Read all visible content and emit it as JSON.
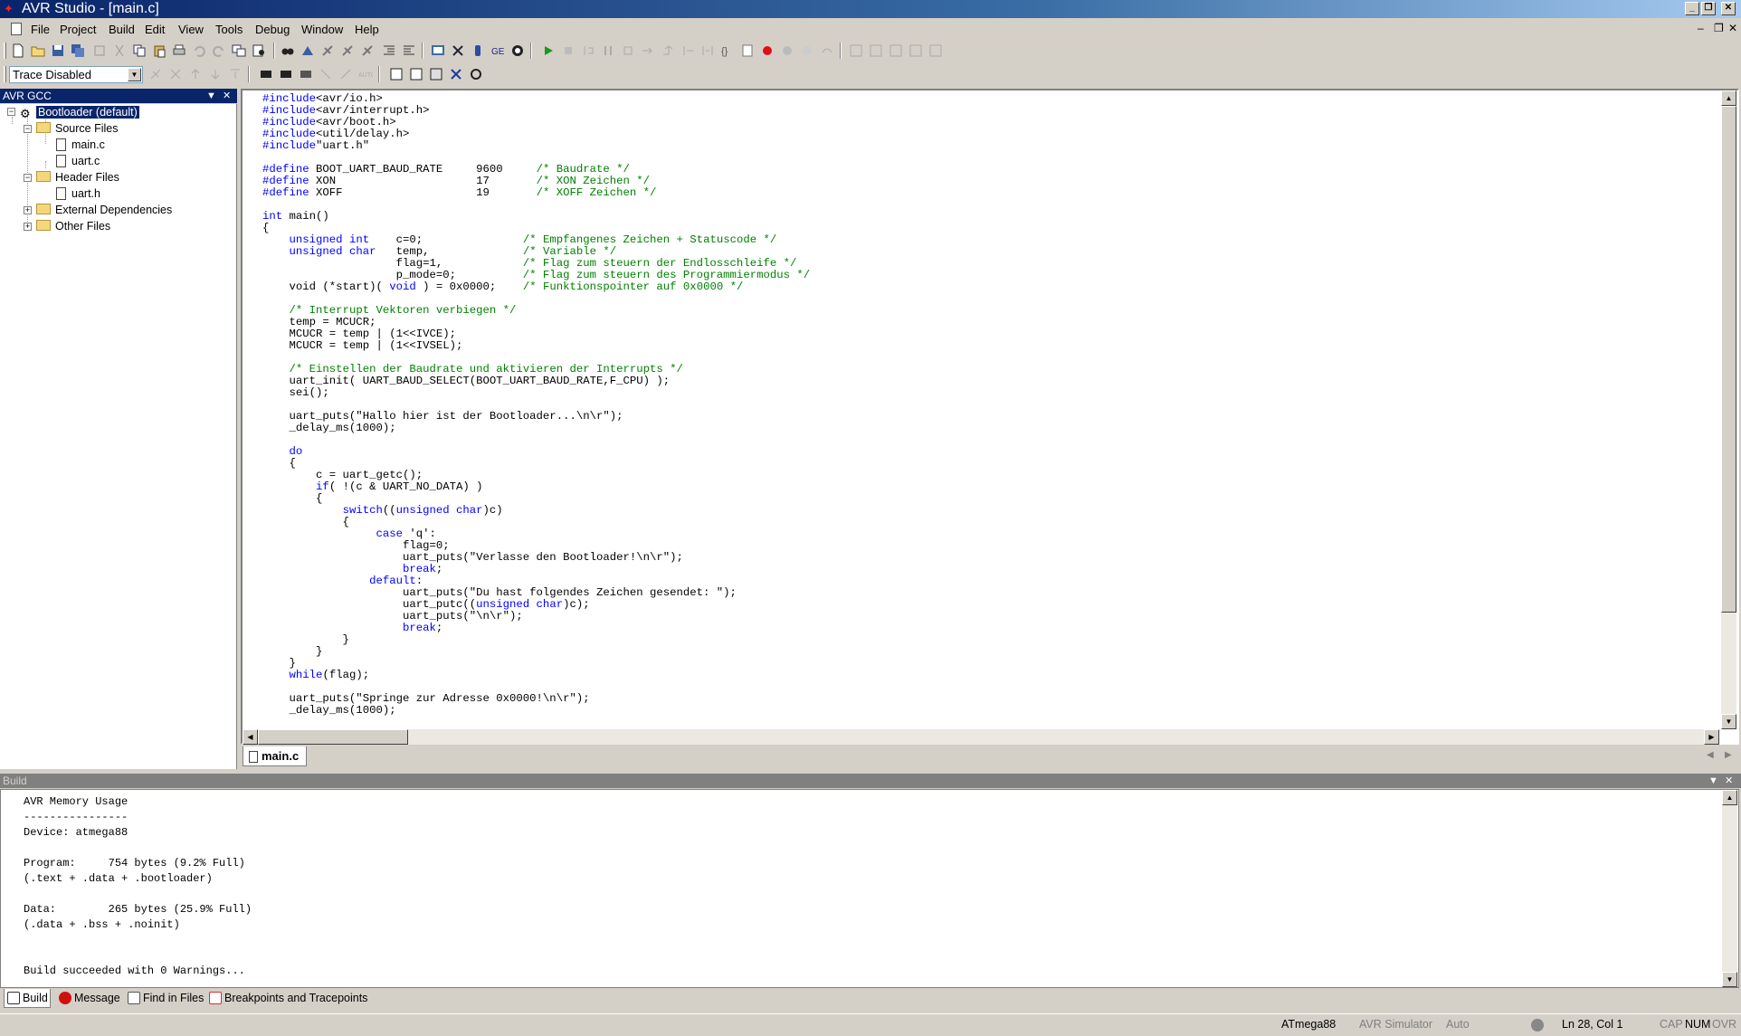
{
  "window": {
    "title": "AVR Studio - [main.c]"
  },
  "menu": [
    "File",
    "Project",
    "Build",
    "Edit",
    "View",
    "Tools",
    "Debug",
    "Window",
    "Help"
  ],
  "trace": {
    "value": "Trace Disabled"
  },
  "project_panel": {
    "title": "AVR GCC",
    "root": "Bootloader (default)",
    "folders": {
      "source": "Source Files",
      "header": "Header Files",
      "external": "External Dependencies",
      "other": "Other Files"
    },
    "files": {
      "main": "main.c",
      "uart_c": "uart.c",
      "uart_h": "uart.h"
    }
  },
  "editor": {
    "active_tab": "main.c",
    "code_lines": [
      [
        [
          "pp",
          "#include"
        ],
        [
          "",
          "<avr/io.h>"
        ]
      ],
      [
        [
          "pp",
          "#include"
        ],
        [
          "",
          "<avr/interrupt.h>"
        ]
      ],
      [
        [
          "pp",
          "#include"
        ],
        [
          "",
          "<avr/boot.h>"
        ]
      ],
      [
        [
          "pp",
          "#include"
        ],
        [
          "",
          "<util/delay.h>"
        ]
      ],
      [
        [
          "pp",
          "#include"
        ],
        [
          "",
          "\"uart.h\""
        ]
      ],
      [],
      [
        [
          "pp",
          "#define"
        ],
        [
          "",
          " BOOT_UART_BAUD_RATE     9600     "
        ],
        [
          "cm",
          "/* Baudrate */"
        ]
      ],
      [
        [
          "pp",
          "#define"
        ],
        [
          "",
          " XON                     17       "
        ],
        [
          "cm",
          "/* XON Zeichen */"
        ]
      ],
      [
        [
          "pp",
          "#define"
        ],
        [
          "",
          " XOFF                    19       "
        ],
        [
          "cm",
          "/* XOFF Zeichen */"
        ]
      ],
      [],
      [
        [
          "kw",
          "int"
        ],
        [
          "",
          " main()"
        ]
      ],
      [
        [
          "",
          "{"
        ]
      ],
      [
        [
          "",
          "    "
        ],
        [
          "kw",
          "unsigned int"
        ],
        [
          "",
          "    c=0;               "
        ],
        [
          "cm",
          "/* Empfangenes Zeichen + Statuscode */"
        ]
      ],
      [
        [
          "",
          "    "
        ],
        [
          "kw",
          "unsigned char"
        ],
        [
          "",
          "   temp,              "
        ],
        [
          "cm",
          "/* Variable */"
        ]
      ],
      [
        [
          "",
          "                    flag=1,            "
        ],
        [
          "cm",
          "/* Flag zum steuern der Endlosschleife */"
        ]
      ],
      [
        [
          "",
          "                    p_mode=0;          "
        ],
        [
          "cm",
          "/* Flag zum steuern des Programmiermodus */"
        ]
      ],
      [
        [
          "",
          "    void (*start)( "
        ],
        [
          "kw",
          "void"
        ],
        [
          "",
          " ) = 0x0000;    "
        ],
        [
          "cm",
          "/* Funktionspointer auf 0x0000 */"
        ]
      ],
      [],
      [
        [
          "",
          "    "
        ],
        [
          "cm",
          "/* Interrupt Vektoren verbiegen */"
        ]
      ],
      [
        [
          "",
          "    temp = MCUCR;"
        ]
      ],
      [
        [
          "",
          "    MCUCR = temp | (1<<IVCE);"
        ]
      ],
      [
        [
          "",
          "    MCUCR = temp | (1<<IVSEL);"
        ]
      ],
      [],
      [
        [
          "",
          "    "
        ],
        [
          "cm",
          "/* Einstellen der Baudrate und aktivieren der Interrupts */"
        ]
      ],
      [
        [
          "",
          "    uart_init( UART_BAUD_SELECT(BOOT_UART_BAUD_RATE,F_CPU) );"
        ]
      ],
      [
        [
          "",
          "    sei();"
        ]
      ],
      [],
      [
        [
          "",
          "    uart_puts(\"Hallo hier ist der Bootloader...\\n\\r\");"
        ]
      ],
      [
        [
          "",
          "    _delay_ms(1000);"
        ]
      ],
      [],
      [
        [
          "",
          "    "
        ],
        [
          "kw",
          "do"
        ]
      ],
      [
        [
          "",
          "    {"
        ]
      ],
      [
        [
          "",
          "        c = uart_getc();"
        ]
      ],
      [
        [
          "",
          "        "
        ],
        [
          "kw",
          "if"
        ],
        [
          "",
          "( !(c & UART_NO_DATA) )"
        ]
      ],
      [
        [
          "",
          "        {"
        ]
      ],
      [
        [
          "",
          "            "
        ],
        [
          "kw",
          "switch"
        ],
        [
          "",
          "(("
        ],
        [
          "kw",
          "unsigned char"
        ],
        [
          "",
          ")c)"
        ]
      ],
      [
        [
          "",
          "            {"
        ]
      ],
      [
        [
          "",
          "                 "
        ],
        [
          "kw",
          "case"
        ],
        [
          "",
          " 'q':"
        ]
      ],
      [
        [
          "",
          "                     flag=0;"
        ]
      ],
      [
        [
          "",
          "                     uart_puts(\"Verlasse den Bootloader!\\n\\r\");"
        ]
      ],
      [
        [
          "",
          "                     "
        ],
        [
          "kw",
          "break"
        ],
        [
          "",
          ";"
        ]
      ],
      [
        [
          "",
          "                "
        ],
        [
          "kw",
          "default"
        ],
        [
          "",
          ":"
        ]
      ],
      [
        [
          "",
          "                     uart_puts(\"Du hast folgendes Zeichen gesendet: \");"
        ]
      ],
      [
        [
          "",
          "                     uart_putc(("
        ],
        [
          "kw",
          "unsigned char"
        ],
        [
          "",
          ")c);"
        ]
      ],
      [
        [
          "",
          "                     uart_puts(\"\\n\\r\");"
        ]
      ],
      [
        [
          "",
          "                     "
        ],
        [
          "kw",
          "break"
        ],
        [
          "",
          ";"
        ]
      ],
      [
        [
          "",
          "            }"
        ]
      ],
      [
        [
          "",
          "        }"
        ]
      ],
      [
        [
          "",
          "    }"
        ]
      ],
      [
        [
          "",
          "    "
        ],
        [
          "kw",
          "while"
        ],
        [
          "",
          "(flag);"
        ]
      ],
      [],
      [
        [
          "",
          "    uart_puts(\"Springe zur Adresse 0x0000!\\n\\r\");"
        ]
      ],
      [
        [
          "",
          "    _delay_ms(1000);"
        ]
      ]
    ]
  },
  "build_panel": {
    "title": "Build",
    "lines": [
      "AVR Memory Usage",
      "----------------",
      "Device: atmega88",
      "",
      "Program:     754 bytes (9.2% Full)",
      "(.text + .data + .bootloader)",
      "",
      "Data:        265 bytes (25.9% Full)",
      "(.data + .bss + .noinit)",
      "",
      "",
      "Build succeeded with 0 Warnings..."
    ],
    "tabs": [
      "Build",
      "Message",
      "Find in Files",
      "Breakpoints and Tracepoints"
    ]
  },
  "status": {
    "device": "ATmega88",
    "platform": "AVR Simulator",
    "mode": "Auto",
    "position": "Ln 28, Col 1",
    "cap": "CAP",
    "num": "NUM",
    "ovr": "OVR"
  },
  "colors": {
    "keyword": "#0000ff",
    "comment": "#008000",
    "selection": "#0a246a"
  }
}
